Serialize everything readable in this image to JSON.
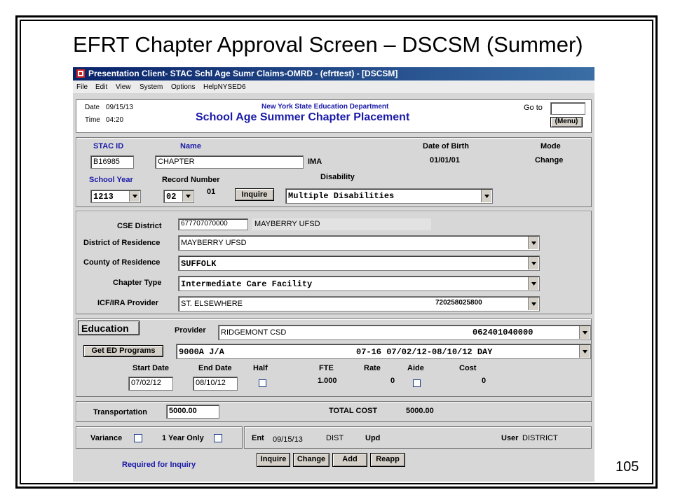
{
  "slide_title": "EFRT Chapter Approval  Screen – DSCSM (Summer)",
  "page_number": "105",
  "window": {
    "title": "Presentation Client- STAC Schl Age Sumr Claims-OMRD - (efrttest) - [DSCSM]"
  },
  "menu": [
    "File",
    "Edit",
    "View",
    "System",
    "Options",
    "HelpNYSED6"
  ],
  "header": {
    "date_label": "Date",
    "date_value": "09/15/13",
    "time_label": "Time",
    "time_value": "04:20",
    "agency": "New York State Education Department",
    "title": "School Age Summer Chapter Placement",
    "goto_label": "Go to",
    "menu_button": "Menu"
  },
  "student": {
    "stac_id_label": "STAC ID",
    "stac_id": "B16985",
    "name_label": "Name",
    "name": "CHAPTER",
    "name_suffix": "IMA",
    "dob_label": "Date of Birth",
    "dob": "01/01/01",
    "mode_label": "Mode",
    "mode": "Change",
    "school_year_label": "School Year",
    "school_year": "1213",
    "record_number_label": "Record Number",
    "record_number_select": "02",
    "record_number": "01",
    "inquire_button": "Inquire",
    "disability_label": "Disability",
    "disability": "Multiple Disabilities"
  },
  "district": {
    "cse_district_label": "CSE District",
    "cse_code": "677707070000",
    "cse_name": "MAYBERRY UFSD",
    "residence_label": "District of Residence",
    "residence": "MAYBERRY UFSD",
    "county_label": "County of Residence",
    "county": "SUFFOLK",
    "chapter_type_label": "Chapter Type",
    "chapter_type": "Intermediate Care Facility",
    "icf_label": "ICF/IRA Provider",
    "icf_provider": "ST. ELSEWHERE",
    "icf_code": "720258025800"
  },
  "education": {
    "section_label": "Education",
    "provider_label": "Provider",
    "provider_name": "RIDGEMONT CSD",
    "provider_code": "062401040000",
    "get_programs_button": "Get ED Programs",
    "program": "9000A J/A",
    "program_detail": "07-16 07/02/12-08/10/12 DAY",
    "start_label": "Start Date",
    "start_date": "07/02/12",
    "end_label": "End Date",
    "end_date": "08/10/12",
    "half_label": "Half",
    "fte_label": "FTE",
    "fte": "1.000",
    "rate_label": "Rate",
    "rate": "0",
    "aide_label": "Aide",
    "cost_label": "Cost",
    "cost": "0"
  },
  "transport": {
    "label": "Transportation",
    "value": "5000.00",
    "total_label": "TOTAL COST",
    "total": "5000.00"
  },
  "footer": {
    "variance_label": "Variance",
    "one_year_label": "1 Year Only",
    "ent_label": "Ent",
    "ent_date": "09/15/13",
    "ent_by": "DIST",
    "upd_label": "Upd",
    "user_label": "User",
    "user": "DISTRICT",
    "required_note": "Required for Inquiry"
  },
  "actions": [
    "Inquire",
    "Change",
    "Add",
    "Reapp"
  ],
  "colors": {
    "label_blue": "#1a1aa8",
    "panel_gray": "#d7d7d7",
    "titlebar": "#0a246a"
  }
}
